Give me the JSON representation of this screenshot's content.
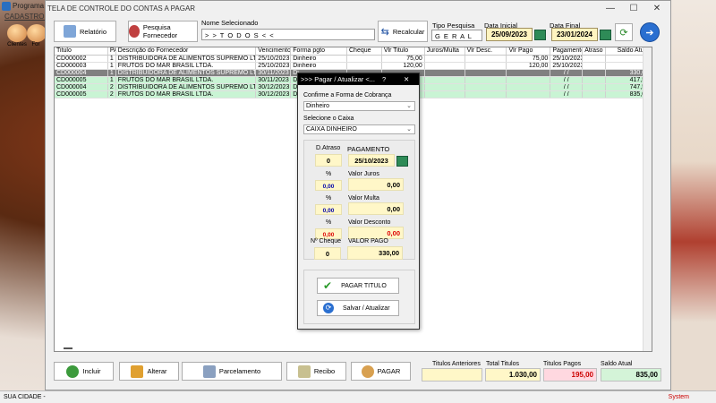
{
  "app": {
    "title": "Programa",
    "menu": "CADASTROS",
    "toolbar": [
      {
        "label": "Clientes"
      },
      {
        "label": "For"
      }
    ]
  },
  "window": {
    "title": "TELA DE CONTROLE DO CONTAS A PAGAR",
    "controls": [
      "—",
      "☐",
      "✕"
    ]
  },
  "toolbar": {
    "relatorio": "Relatório",
    "pesquisa_fornecedor": "Pesquisa Fornecedor",
    "nome_label": "Nome Selecionado",
    "nome_value": "> > T O D O S < <",
    "recalcular": "Recalcular",
    "tipo_label": "Tipo  Pesquisa",
    "tipo_value": "G E R A L",
    "data_inicial_label": "Data Inicial",
    "data_inicial": "25/09/2023",
    "data_final_label": "Data Final",
    "data_final": "23/01/2024"
  },
  "grid": {
    "headers": [
      "Titulo",
      "PA",
      "Descrição do Fornecedor",
      "Vencimento",
      "Forma pgto",
      "Cheque",
      "Vlr Titulo",
      "Juros/Multa",
      "Vlr Desc.",
      "Vlr Pago",
      "Pagamento",
      "Atraso",
      "Saldo Atual"
    ],
    "rows": [
      [
        "CD000002",
        "1",
        "DISTRIBUIDORA DE ALIMENTOS SUPREMO LTDA.",
        "25/10/2023",
        "Dinheiro",
        "",
        "75,00",
        "",
        "",
        "75,00",
        "25/10/2023",
        "",
        ""
      ],
      [
        "CD000003",
        "1",
        "FRUTOS DO MAR BRASIL LTDA.",
        "25/10/2023",
        "Dinheiro",
        "",
        "120,00",
        "",
        "",
        "120,00",
        "25/10/2023",
        "",
        ""
      ],
      [
        "CD000004",
        "1",
        "DISTRIBUIDORA DE ALIMENTOS SUPREMO LTDA.",
        "30/11/2023",
        "Di",
        "",
        "",
        "",
        "",
        "",
        "/ /",
        "",
        "330,00"
      ],
      [
        "CD000005",
        "1",
        "FRUTOS DO MAR BRASIL LTDA.",
        "30/11/2023",
        "Di",
        "",
        "",
        "",
        "",
        "",
        "/ /",
        "",
        "417,50"
      ],
      [
        "CD000004",
        "2",
        "DISTRIBUIDORA DE ALIMENTOS SUPREMO LTDA.",
        "30/12/2023",
        "Di",
        "",
        "",
        "",
        "",
        "",
        "/ /",
        "",
        "747,50"
      ],
      [
        "CD000005",
        "2",
        "FRUTOS DO MAR BRASIL LTDA.",
        "30/12/2023",
        "Di",
        "",
        "",
        "",
        "",
        "",
        "/ /",
        "",
        "835,00"
      ]
    ]
  },
  "bottom": {
    "incluir": "Incluir",
    "alterar": "Alterar",
    "parcelamento": "Parcelamento",
    "recibo": "Recibo",
    "pagar": "PAGAR",
    "titulos_anteriores_label": "Titulos Anteriores",
    "titulos_anteriores": "",
    "total_titulos_label": "Total Titulos",
    "total_titulos": "1.030,00",
    "titulos_pagos_label": "Titulos Pagos",
    "titulos_pagos": "195,00",
    "saldo_atual_label": "Saldo Atual",
    "saldo_atual": "835,00"
  },
  "dialog": {
    "title": ">>> Pagar / Atualizar <...",
    "help": "?",
    "close": "✕",
    "forma_label": "Confirme a Forma de Cobrança",
    "forma_value": "Dinheiro",
    "caixa_label": "Selecione o Caixa",
    "caixa_value": "CAIXA DINHEIRO",
    "atraso_label": "D.Atraso",
    "atraso_value": "0",
    "pagamento_label": "PAGAMENTO",
    "pagamento_value": "25/10/2023",
    "pct": "%",
    "juros_pct": "0,00",
    "juros_label": "Valor Juros",
    "juros_value": "0,00",
    "multa_pct": "0,00",
    "multa_label": "Valor Multa",
    "multa_value": "0,00",
    "desc_pct": "0,00",
    "desc_label": "Valor Desconto",
    "desc_value": "0,00",
    "cheque_label": "Nº Cheque",
    "cheque_value": "0",
    "valor_pago_label": "VALOR PAGO",
    "valor_pago_value": "330,00",
    "pagar_titulo": "PAGAR TITULO",
    "salvar": "Salvar / Atualizar"
  },
  "status": {
    "left": "SUA CIDADE -",
    "right": "System"
  },
  "colors": {
    "selected_row": "#808080",
    "green_row": "#c9f4d4",
    "yellow_field": "#fff7c8",
    "red_value": "#dd0000",
    "blue_value": "#0000aa"
  }
}
